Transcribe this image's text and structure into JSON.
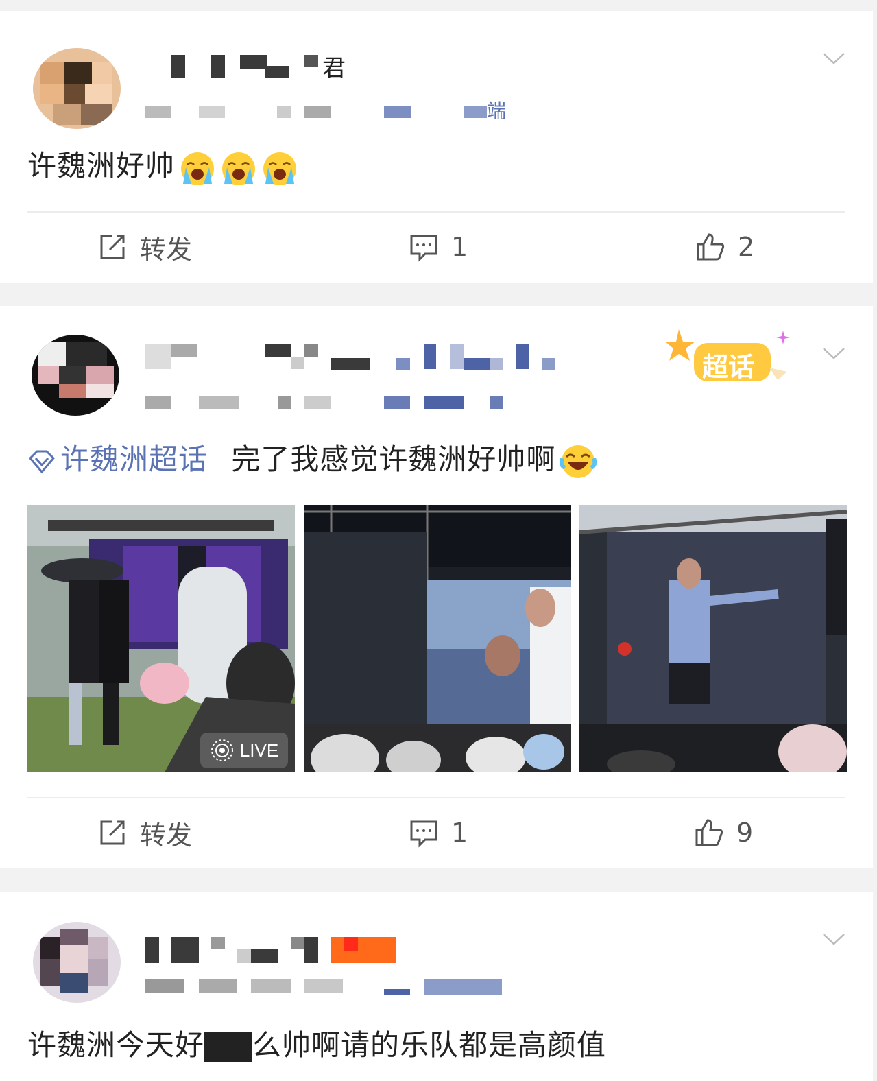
{
  "posts": [
    {
      "text": "许魏洲好帅",
      "emojis": [
        "crying-emoji",
        "crying-emoji",
        "crying-emoji"
      ],
      "source_suffix": "端",
      "name_suffix": "君",
      "actions": {
        "repost_label": "转发",
        "comment_count": "1",
        "like_count": "2"
      }
    },
    {
      "topic": "许魏洲超话",
      "text": "完了我感觉许魏洲好帅啊",
      "emojis": [
        "laughing-crying-emoji"
      ],
      "super_topic_badge": "超话",
      "images": [
        {
          "desc": "concert-crowd-umbrella-photo",
          "live_label": "LIVE"
        },
        {
          "desc": "stage-screen-singer-photo"
        },
        {
          "desc": "screen-singer-arm-outstretched-photo"
        }
      ],
      "actions": {
        "repost_label": "转发",
        "comment_count": "1",
        "like_count": "9"
      }
    },
    {
      "text_a": "许魏洲今天好",
      "text_b": "么帅啊请的",
      "text_c": "乐队都是高颜值"
    }
  ],
  "colors": {
    "accent": "#5b73b3",
    "background": "#f2f2f2",
    "card": "#ffffff"
  }
}
